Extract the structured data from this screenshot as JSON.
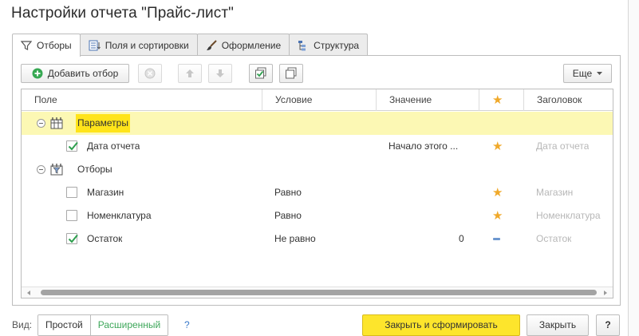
{
  "window": {
    "title": "Настройки отчета \"Прайс-лист\""
  },
  "tabs": [
    {
      "label": "Отборы",
      "icon": "filter-icon",
      "active": true
    },
    {
      "label": "Поля и сортировки",
      "icon": "fields-icon",
      "active": false
    },
    {
      "label": "Оформление",
      "icon": "brush-icon",
      "active": false
    },
    {
      "label": "Структура",
      "icon": "structure-icon",
      "active": false
    }
  ],
  "toolbar": {
    "add_filter_label": "Добавить отбор",
    "more_label": "Еще"
  },
  "table": {
    "columns": [
      "Поле",
      "Условие",
      "Значение",
      "★",
      "Заголовок"
    ],
    "rows": [
      {
        "type": "group",
        "field": "Параметры",
        "selected": true
      },
      {
        "type": "item",
        "checked": true,
        "field": "Дата отчета",
        "condition": "",
        "value": "Начало этого ...",
        "mark": "star",
        "caption": "Дата отчета"
      },
      {
        "type": "group",
        "field": "Отборы",
        "selected": false
      },
      {
        "type": "item",
        "checked": false,
        "field": "Магазин",
        "condition": "Равно",
        "value": "",
        "mark": "star",
        "caption": "Магазин"
      },
      {
        "type": "item",
        "checked": false,
        "field": "Номенклатура",
        "condition": "Равно",
        "value": "",
        "mark": "star",
        "caption": "Номенклатура"
      },
      {
        "type": "item",
        "checked": true,
        "field": "Остаток",
        "condition": "Не равно",
        "value": "0",
        "mark": "dash",
        "caption": "Остаток"
      }
    ]
  },
  "footer": {
    "view_label": "Вид:",
    "mode_simple": "Простой",
    "mode_extended": "Расширенный",
    "help_label": "?",
    "generate_label": "Закрыть и сформировать",
    "close_label": "Закрыть",
    "question_label": "?"
  },
  "colors": {
    "accent_yellow": "#fde52c",
    "selected_row": "#fcf8b4",
    "star": "#f0a92a",
    "check_green": "#2e9f4e"
  }
}
